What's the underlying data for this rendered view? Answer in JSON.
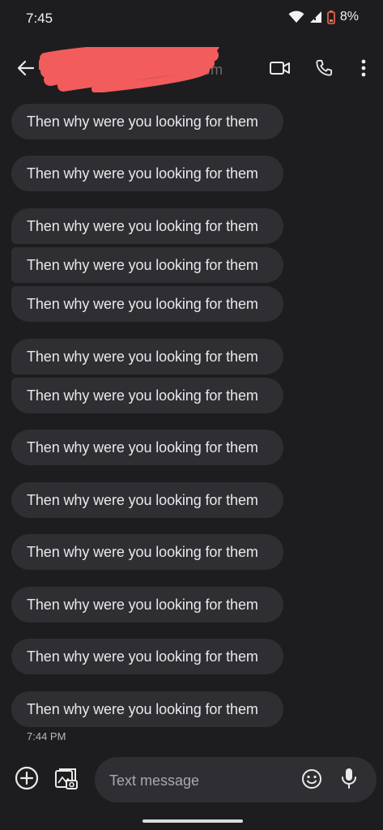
{
  "status_bar": {
    "time": "7:45",
    "battery": "8%"
  },
  "header": {
    "contact_name": "hem",
    "icons": [
      "back-arrow-icon",
      "video-call-icon",
      "phone-icon",
      "more-vert-icon"
    ]
  },
  "messages": [
    {
      "text": "Then why were you looking for them"
    },
    {
      "text": "Then why were you looking for them"
    },
    {
      "text": "Then why were you looking for them"
    },
    {
      "text": "Then why were you looking for them"
    },
    {
      "text": "Then why were you looking for them"
    },
    {
      "text": "Then why were you looking for them"
    },
    {
      "text": "Then why were you looking for them"
    },
    {
      "text": "Then why were you looking for them"
    },
    {
      "text": "Then why were you looking for them"
    },
    {
      "text": "Then why were you looking for them"
    },
    {
      "text": "Then why were you looking for them"
    },
    {
      "text": "Then why were you looking for them"
    },
    {
      "text": "Then why were you looking for them"
    }
  ],
  "timestamp": "7:44 PM",
  "compose": {
    "placeholder": "Text message",
    "value": ""
  },
  "colors": {
    "background": "#1d1d1f",
    "bubble": "#2f2f33",
    "redaction": "#f25c5c",
    "battery_low": "#f26b4f"
  }
}
